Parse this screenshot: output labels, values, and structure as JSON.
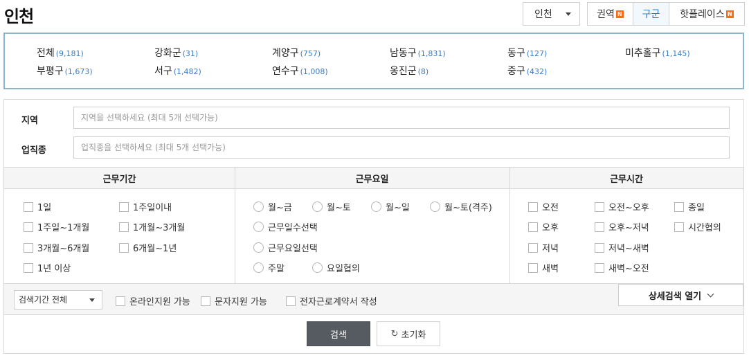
{
  "page": {
    "title": "인천"
  },
  "city_select": {
    "value": "인천"
  },
  "view_tabs": [
    {
      "label": "권역",
      "badge": "N"
    },
    {
      "label": "구군",
      "badge": ""
    },
    {
      "label": "핫플레이스",
      "badge": "N"
    }
  ],
  "districts": [
    {
      "name": "전체",
      "count": "(9,181)"
    },
    {
      "name": "강화군",
      "count": "(31)"
    },
    {
      "name": "계양구",
      "count": "(757)"
    },
    {
      "name": "남동구",
      "count": "(1,831)"
    },
    {
      "name": "동구",
      "count": "(127)"
    },
    {
      "name": "미추홀구",
      "count": "(1,145)"
    },
    {
      "name": "부평구",
      "count": "(1,673)"
    },
    {
      "name": "서구",
      "count": "(1,482)"
    },
    {
      "name": "연수구",
      "count": "(1,008)"
    },
    {
      "name": "옹진군",
      "count": "(8)"
    },
    {
      "name": "중구",
      "count": "(432)"
    }
  ],
  "filters": {
    "region": {
      "label": "지역",
      "placeholder": "지역을 선택하세요 (최대 5개 선택가능)"
    },
    "job": {
      "label": "업직종",
      "placeholder": "업직종을 선택하세요 (최대 5개 선택가능)"
    }
  },
  "period": {
    "title": "근무기간",
    "options": [
      "1일",
      "1주일이내",
      "1주일~1개월",
      "1개월~3개월",
      "3개월~6개월",
      "6개월~1년",
      "1년 이상"
    ]
  },
  "days": {
    "title": "근무요일",
    "options": [
      "월~금",
      "월~토",
      "월~일",
      "월~토(격주)",
      "근무일수선택",
      "근무요일선택",
      "주말",
      "요일협의"
    ]
  },
  "hours": {
    "title": "근무시간",
    "options": [
      "오전",
      "오전~오후",
      "종일",
      "오후",
      "오후~저녁",
      "시간협의",
      "저녁",
      "저녁~새벽",
      "새벽",
      "새벽~오전"
    ]
  },
  "bottom": {
    "period_select": "검색기간 전체",
    "checks": [
      "온라인지원 가능",
      "문자지원 가능",
      "전자근로계약서 작성"
    ],
    "detail_button": "상세검색 열기"
  },
  "actions": {
    "search": "검색",
    "reset": "초기화"
  },
  "icons": {
    "caret": "caret-down-icon",
    "chevron": "chevron-down-icon",
    "reset": "refresh-icon",
    "new_badge": "new-badge-icon"
  },
  "colors": {
    "accent": "#2b7bd0",
    "count": "#3a7cc4",
    "border_highlight": "#8db4cf",
    "new_badge": "#ff6b1a",
    "search_button": "#565b61"
  }
}
